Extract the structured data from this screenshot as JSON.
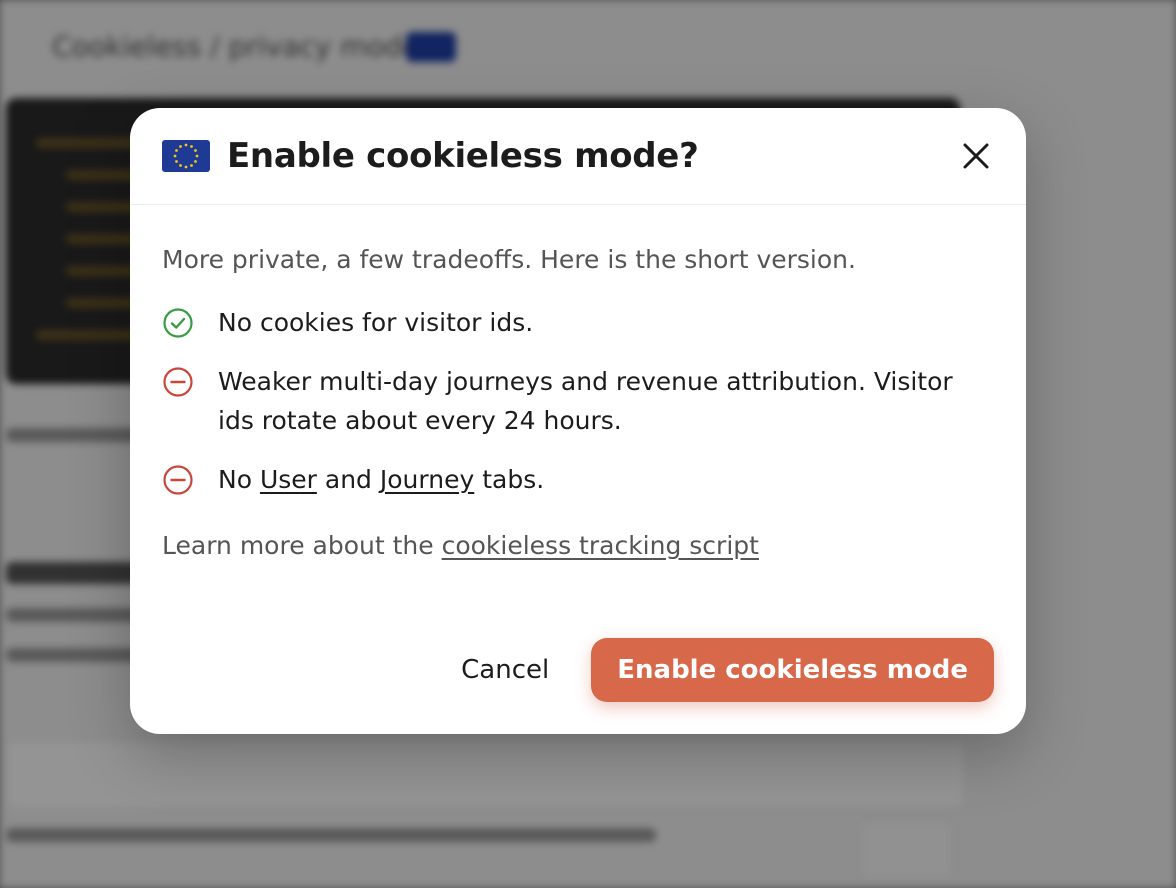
{
  "colors": {
    "accent": "#d8684a",
    "check_green": "#3a9a45",
    "minus_red": "#c8473b",
    "eu_blue": "#1e3a94",
    "eu_gold": "#f5c518"
  },
  "modal": {
    "title": "Enable cookieless mode?",
    "flag_icon": "eu-flag-icon",
    "close_icon": "close-icon",
    "intro": "More private, a few tradeoffs. Here is the short version.",
    "items": [
      {
        "icon": "check-circle-icon",
        "text": "No cookies for visitor ids."
      },
      {
        "icon": "minus-circle-icon",
        "text": "Weaker multi-day journeys and revenue attribution. Visitor ids rotate about every 24 hours."
      },
      {
        "icon": "minus-circle-icon",
        "prefix": "No",
        "link1": "User",
        "middle": "and",
        "link2": "Journey",
        "suffix": "tabs."
      }
    ],
    "learn_more_prefix": "Learn more about the",
    "learn_more_link": "cookieless tracking script",
    "cancel_label": "Cancel",
    "confirm_label": "Enable cookieless mode"
  }
}
